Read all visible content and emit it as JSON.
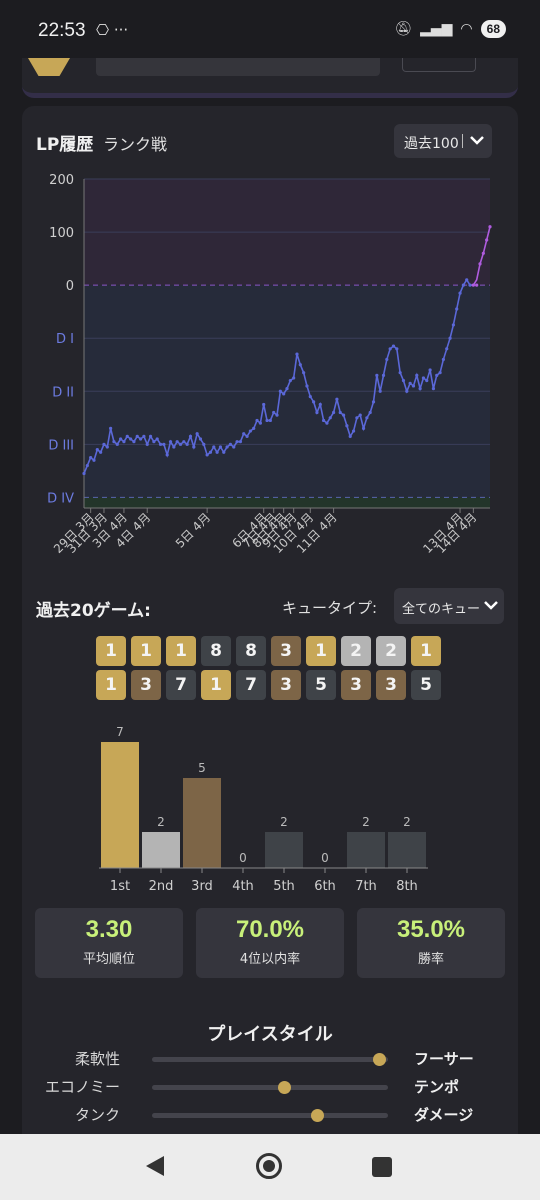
{
  "status_bar": {
    "time": "22:53",
    "left_icons": "⎔ ···",
    "battery": "68"
  },
  "lp_history": {
    "title": "LP履歴",
    "subtitle": "ランク戦",
    "range_value": "過去100",
    "chart_data": {
      "type": "line",
      "ytick_labels": [
        "200",
        "100",
        "0",
        "D I",
        "D II",
        "D III",
        "D IV"
      ],
      "xtick_labels": [
        "29日 3月",
        "31日 3月",
        "3日 4月",
        "4日 4月",
        "5日 4月",
        "6日 4月",
        "7日 4月",
        "8日 4月",
        "9日 4月",
        "10日 4月",
        "11日 4月",
        "13日 4月",
        "14日 4月"
      ],
      "y_unit": "LP",
      "ylim": [
        -420,
        200
      ],
      "grid": true,
      "series": [
        {
          "values": [
            -355,
            -340,
            -325,
            -330,
            -310,
            -315,
            -300,
            -305,
            -270,
            -295,
            -300,
            -290,
            -295,
            -285,
            -290,
            -295,
            -285,
            -290,
            -285,
            -300,
            -285,
            -295,
            -290,
            -300,
            -300,
            -320,
            -295,
            -305,
            -295,
            -300,
            -295,
            -300,
            -285,
            -305,
            -280,
            -290,
            -300,
            -320,
            -315,
            -305,
            -315,
            -305,
            -315,
            -305,
            -300,
            -305,
            -295,
            -295,
            -280,
            -285,
            -275,
            -270,
            -255,
            -260,
            -225,
            -255,
            -255,
            -240,
            -245,
            -200,
            -205,
            -195,
            -180,
            -175,
            -130,
            -150,
            -165,
            -190,
            -210,
            -220,
            -240,
            -225,
            -255,
            -260,
            -250,
            -240,
            -215,
            -240,
            -245,
            -265,
            -285,
            -275,
            -250,
            -245,
            -270,
            -250,
            -240,
            -220,
            -170,
            -200,
            -170,
            -140,
            -120,
            -115,
            -120,
            -165,
            -180,
            -200,
            -185,
            -190,
            -170,
            -195,
            -175,
            -180,
            -160,
            -195,
            -170,
            -165,
            -140,
            -120,
            -100,
            -75,
            -45,
            -15,
            0,
            10,
            0,
            0,
            0,
            40,
            60,
            85,
            110
          ]
        },
        {
          "values": [
            0,
            0,
            10,
            40,
            60,
            85,
            110
          ]
        }
      ]
    }
  },
  "recent": {
    "title": "過去20ゲーム:",
    "queue_label": "キュータイプ:",
    "queue_value": "全てのキュー",
    "placements": [
      1,
      1,
      1,
      8,
      8,
      3,
      1,
      2,
      2,
      1,
      1,
      3,
      7,
      1,
      7,
      3,
      5,
      3,
      3,
      5
    ],
    "chart_data": {
      "type": "bar",
      "categories": [
        "1st",
        "2nd",
        "3rd",
        "4th",
        "5th",
        "6th",
        "7th",
        "8th"
      ],
      "values": [
        7,
        2,
        5,
        0,
        2,
        0,
        2,
        2
      ]
    }
  },
  "stats": [
    {
      "value": "3.30",
      "label": "平均順位"
    },
    {
      "value": "70.0%",
      "label": "4位以内率"
    },
    {
      "value": "35.0%",
      "label": "勝率"
    }
  ],
  "playstyle": {
    "title": "プレイスタイル",
    "rows": [
      {
        "left": "柔軟性",
        "right": "フーサー",
        "level": 0.96
      },
      {
        "left": "エコノミー",
        "right": "テンポ",
        "level": 0.56
      },
      {
        "left": "タンク",
        "right": "ダメージ",
        "level": 0.7
      }
    ]
  },
  "colors": {
    "gold": "#c7a757",
    "silver": "#b4b4b4",
    "bronze": "#7d6547",
    "gray": "#3f4348",
    "line_blue": "#5b68d8",
    "line_purple": "#b05ce0",
    "stat_green": "#c8f07a"
  }
}
